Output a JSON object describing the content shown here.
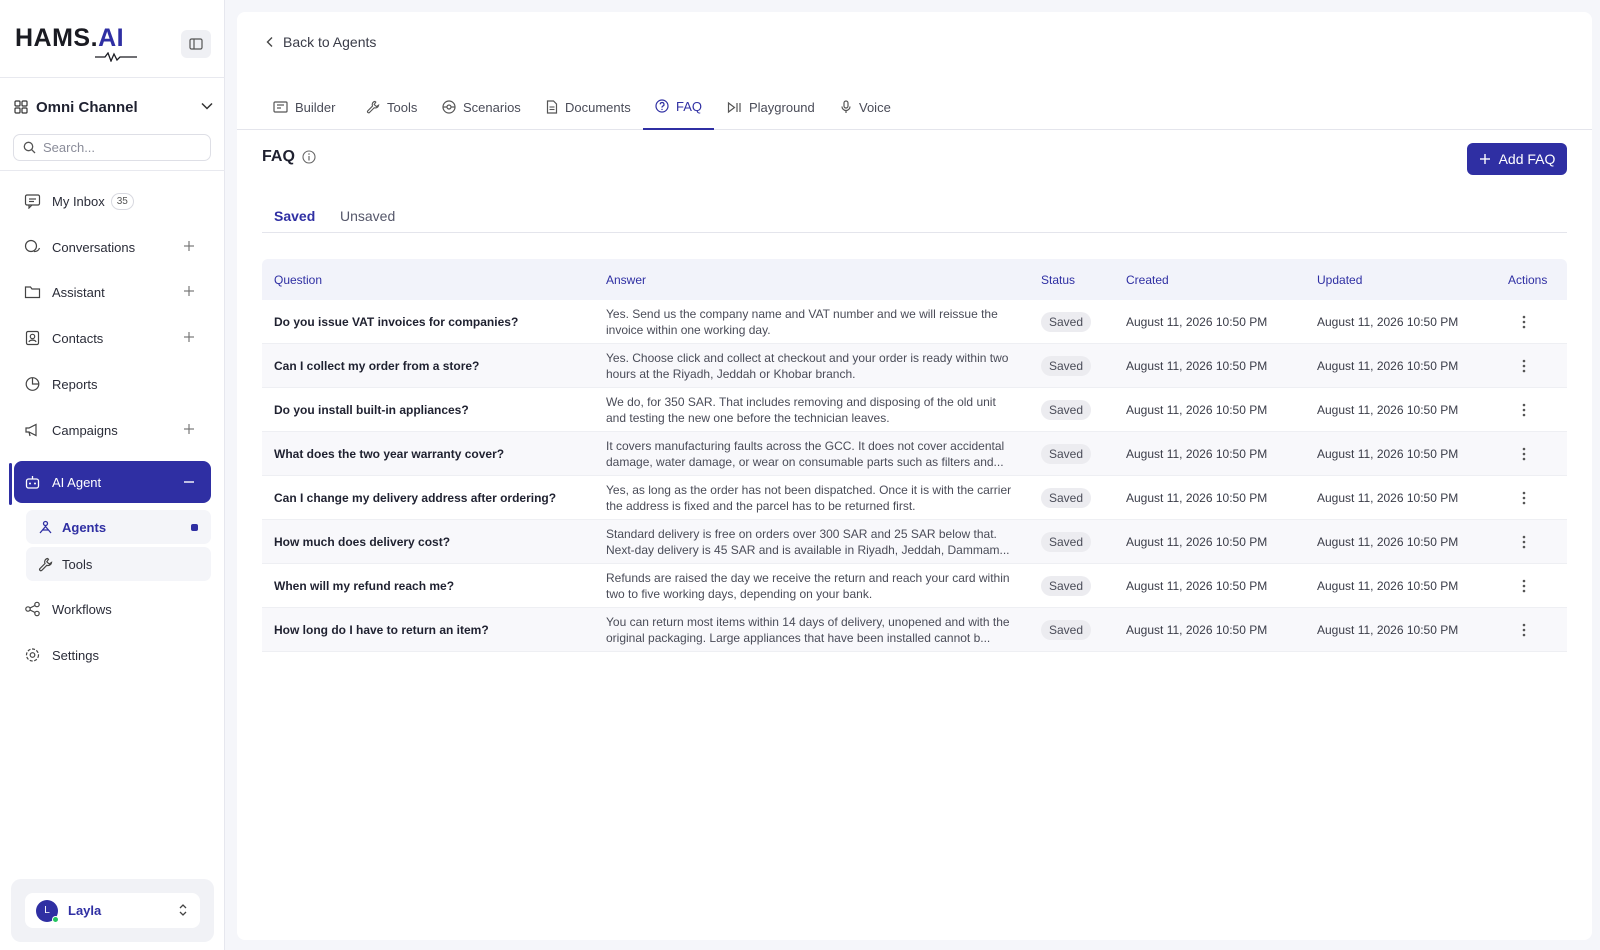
{
  "brand": {
    "name": "HAMS.",
    "suffix": "AI"
  },
  "channel": {
    "label": "Omni Channel"
  },
  "search": {
    "placeholder": "Search..."
  },
  "nav": {
    "inbox": {
      "label": "My Inbox",
      "count": "35"
    },
    "conversations": {
      "label": "Conversations"
    },
    "assistant": {
      "label": "Assistant"
    },
    "contacts": {
      "label": "Contacts"
    },
    "reports": {
      "label": "Reports"
    },
    "campaigns": {
      "label": "Campaigns"
    },
    "ai_agent": {
      "label": "AI Agent"
    },
    "agents": {
      "label": "Agents"
    },
    "tools": {
      "label": "Tools"
    },
    "workflows": {
      "label": "Workflows"
    },
    "settings": {
      "label": "Settings"
    }
  },
  "user": {
    "initial": "L",
    "name": "Layla"
  },
  "back": {
    "label": "Back to Agents"
  },
  "tabs": [
    {
      "label": "Builder",
      "icon": "builder-icon"
    },
    {
      "label": "Tools",
      "icon": "wrench-icon"
    },
    {
      "label": "Scenarios",
      "icon": "scenarios-icon"
    },
    {
      "label": "Documents",
      "icon": "document-icon"
    },
    {
      "label": "FAQ",
      "icon": "question-icon"
    },
    {
      "label": "Playground",
      "icon": "play-icon"
    },
    {
      "label": "Voice",
      "icon": "microphone-icon"
    }
  ],
  "section": {
    "title": "FAQ",
    "add_label": "Add FAQ"
  },
  "subtabs": {
    "saved": "Saved",
    "unsaved": "Unsaved"
  },
  "table": {
    "headers": {
      "question": "Question",
      "answer": "Answer",
      "status": "Status",
      "created": "Created",
      "updated": "Updated",
      "actions": "Actions"
    },
    "rows": [
      {
        "question": "Do you issue VAT invoices for companies?",
        "answer": "Yes. Send us the company name and VAT number and we will reissue the invoice within one working day.",
        "status": "Saved",
        "created": "August 11, 2026 10:50 PM",
        "updated": "August 11, 2026 10:50 PM"
      },
      {
        "question": "Can I collect my order from a store?",
        "answer": "Yes. Choose click and collect at checkout and your order is ready within two hours at the Riyadh, Jeddah or Khobar branch.",
        "status": "Saved",
        "created": "August 11, 2026 10:50 PM",
        "updated": "August 11, 2026 10:50 PM"
      },
      {
        "question": "Do you install built-in appliances?",
        "answer": "We do, for 350 SAR. That includes removing and disposing of the old unit and testing the new one before the technician leaves.",
        "status": "Saved",
        "created": "August 11, 2026 10:50 PM",
        "updated": "August 11, 2026 10:50 PM"
      },
      {
        "question": "What does the two year warranty cover?",
        "answer": "It covers manufacturing faults across the GCC. It does not cover accidental damage, water damage, or wear on consumable parts such as filters and...",
        "status": "Saved",
        "created": "August 11, 2026 10:50 PM",
        "updated": "August 11, 2026 10:50 PM"
      },
      {
        "question": "Can I change my delivery address after ordering?",
        "answer": "Yes, as long as the order has not been dispatched. Once it is with the carrier the address is fixed and the parcel has to be returned first.",
        "status": "Saved",
        "created": "August 11, 2026 10:50 PM",
        "updated": "August 11, 2026 10:50 PM"
      },
      {
        "question": "How much does delivery cost?",
        "answer": "Standard delivery is free on orders over 300 SAR and 25 SAR below that. Next-day delivery is 45 SAR and is available in Riyadh, Jeddah, Dammam...",
        "status": "Saved",
        "created": "August 11, 2026 10:50 PM",
        "updated": "August 11, 2026 10:50 PM"
      },
      {
        "question": "When will my refund reach me?",
        "answer": "Refunds are raised the day we receive the return and reach your card within two to five working days, depending on your bank.",
        "status": "Saved",
        "created": "August 11, 2026 10:50 PM",
        "updated": "August 11, 2026 10:50 PM"
      },
      {
        "question": "How long do I have to return an item?",
        "answer": "You can return most items within 14 days of delivery, unopened and with the original packaging. Large appliances that have been installed cannot b...",
        "status": "Saved",
        "created": "August 11, 2026 10:50 PM",
        "updated": "August 11, 2026 10:50 PM"
      }
    ]
  }
}
